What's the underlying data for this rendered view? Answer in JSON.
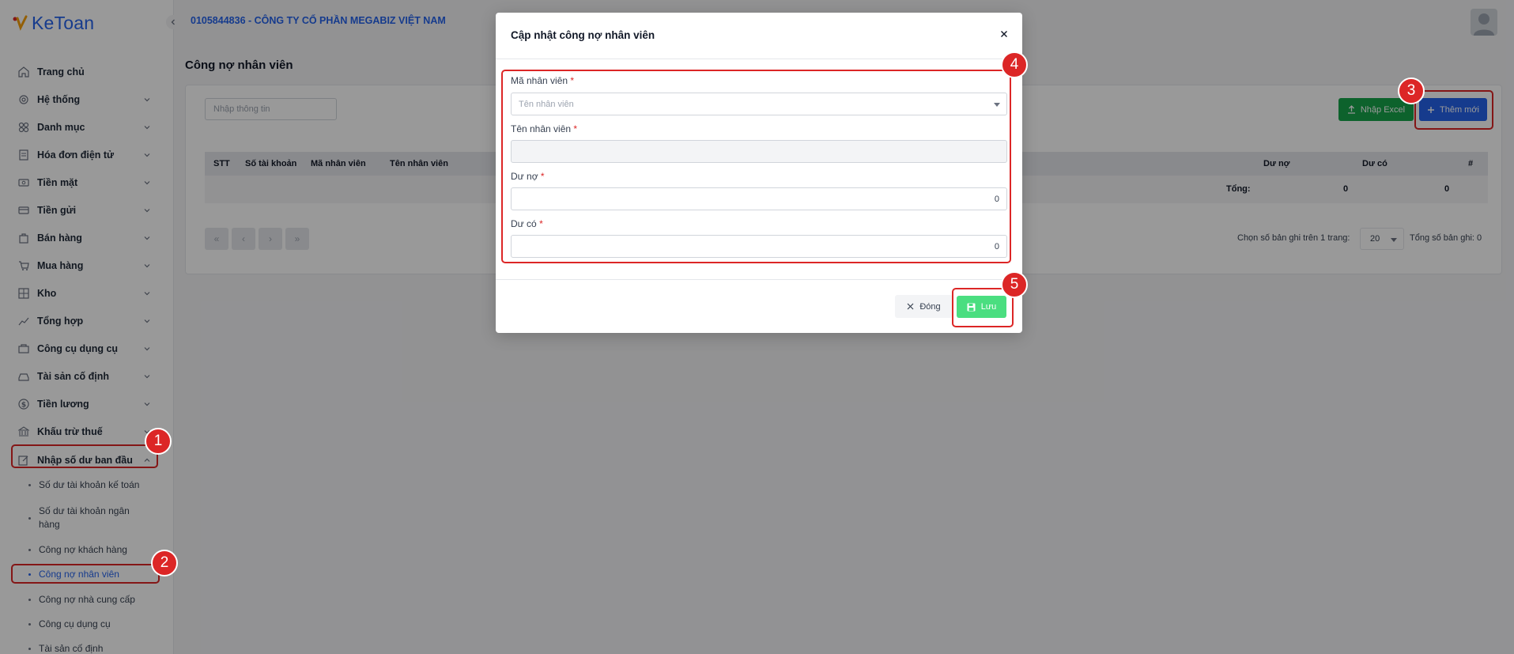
{
  "app": {
    "logo_text": "KeToan",
    "company": "0105844836 - CÔNG TY CỔ PHẦN MEGABIZ VIỆT NAM"
  },
  "sidebar": {
    "items": [
      {
        "label": "Trang chủ",
        "icon": "home-icon"
      },
      {
        "label": "Hệ thống",
        "icon": "gear-icon"
      },
      {
        "label": "Danh mục",
        "icon": "grid-icon"
      },
      {
        "label": "Hóa đơn điện tử",
        "icon": "invoice-icon"
      },
      {
        "label": "Tiền mặt",
        "icon": "cash-icon"
      },
      {
        "label": "Tiền gửi",
        "icon": "card-icon"
      },
      {
        "label": "Bán hàng",
        "icon": "bag-icon"
      },
      {
        "label": "Mua hàng",
        "icon": "cart-icon"
      },
      {
        "label": "Kho",
        "icon": "warehouse-icon"
      },
      {
        "label": "Tổng hợp",
        "icon": "chart-icon"
      },
      {
        "label": "Công cụ dụng cụ",
        "icon": "tools-icon"
      },
      {
        "label": "Tài sản cố định",
        "icon": "car-icon"
      },
      {
        "label": "Tiền lương",
        "icon": "dollar-icon"
      },
      {
        "label": "Khấu trừ thuế",
        "icon": "bank-icon"
      },
      {
        "label": "Nhập số dư ban đầu",
        "icon": "edit-icon"
      }
    ],
    "subitems": [
      "Số dư tài khoản kế toán",
      "Số dư tài khoản ngân hàng",
      "Công nợ khách hàng",
      "Công nợ nhân viên",
      "Công nợ nhà cung cấp",
      "Công cụ dụng cụ",
      "Tài sản cố định"
    ]
  },
  "page": {
    "title": "Công nợ nhân viên",
    "search_placeholder": "Nhập thông tin",
    "btn_excel": "Nhập Excel",
    "btn_add": "Thêm mới",
    "table": {
      "columns": [
        "STT",
        "Số tài khoản",
        "Mã nhân viên",
        "Tên nhân viên",
        "Dư nợ",
        "Dư có",
        "#"
      ],
      "total_label": "Tổng:",
      "total_debit": "0",
      "total_credit": "0"
    },
    "pagination": {
      "first": "«",
      "prev": "‹",
      "next": "›",
      "last": "»",
      "per_page_label": "Chọn số bản ghi trên 1 trang:",
      "per_page": "20",
      "total_label": "Tổng số bản ghi: 0"
    }
  },
  "modal": {
    "title": "Cập nhật công nợ nhân viên",
    "fields": {
      "employee_code": {
        "label": "Mã nhân viên",
        "placeholder": "Tên nhân viên"
      },
      "employee_name": {
        "label": "Tên nhân viên",
        "value": ""
      },
      "debit": {
        "label": "Dư nợ",
        "value": "0"
      },
      "credit": {
        "label": "Dư có",
        "value": "0"
      }
    },
    "required_mark": "*",
    "btn_close": "Đóng",
    "btn_save": "Lưu"
  },
  "annotations": [
    "1",
    "2",
    "3",
    "4",
    "5"
  ],
  "colors": {
    "primary": "#2563eb",
    "success": "#16a34a",
    "save_disabled": "#4ade80",
    "annotation": "#dc2626"
  }
}
